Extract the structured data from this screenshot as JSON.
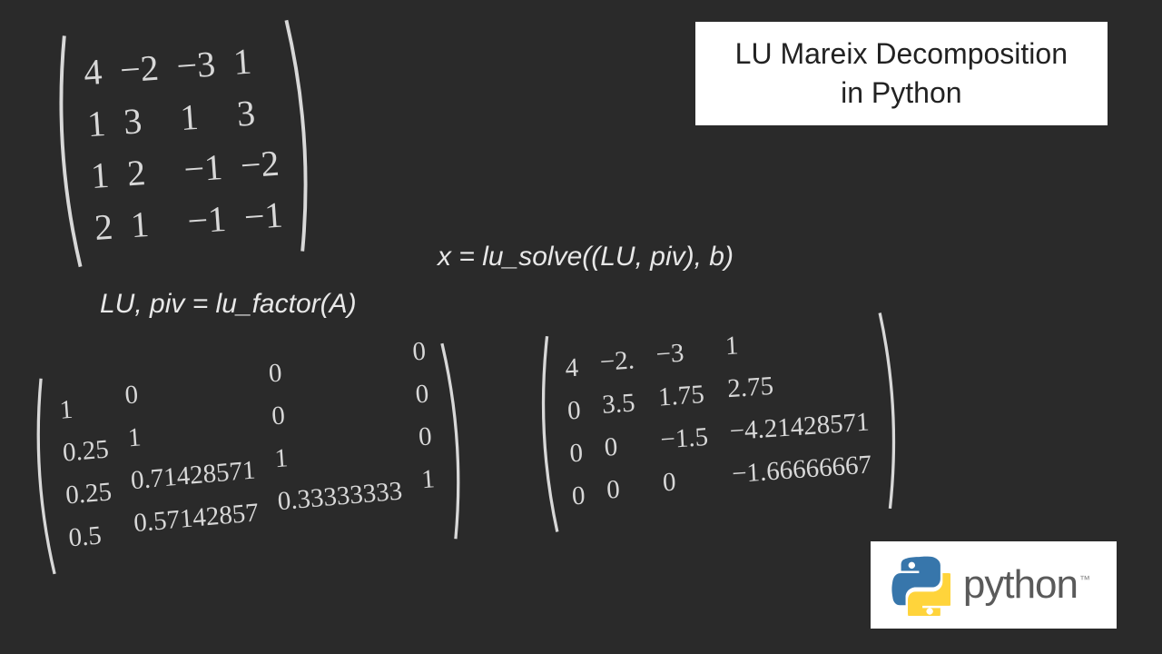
{
  "title": {
    "line1": "LU Mareix Decomposition",
    "line2": "in Python"
  },
  "code": {
    "factor": "LU, piv = lu_factor(A)",
    "solve": "x = lu_solve((LU, piv), b)"
  },
  "matrix_A": [
    [
      "4",
      "−2",
      "−3",
      "1"
    ],
    [
      "1",
      "3",
      "1",
      "3"
    ],
    [
      "1",
      "2",
      "−1",
      "−2"
    ],
    [
      "2",
      "1",
      "−1",
      "−1"
    ]
  ],
  "matrix_L": [
    [
      "1",
      "0",
      "0",
      "0"
    ],
    [
      "0.25",
      "1",
      "0",
      "0"
    ],
    [
      "0.25",
      "0.71428571",
      "1",
      "0"
    ],
    [
      "0.5",
      "0.57142857",
      "0.33333333",
      "1"
    ]
  ],
  "matrix_U": [
    [
      "4",
      "−2.",
      "−3",
      "1"
    ],
    [
      "0",
      "3.5",
      "1.75",
      "2.75"
    ],
    [
      "0",
      "0",
      "−1.5",
      "−4.21428571"
    ],
    [
      "0",
      "0",
      "0",
      "−1.66666667"
    ]
  ],
  "logo": {
    "name": "python",
    "tm": "™"
  }
}
